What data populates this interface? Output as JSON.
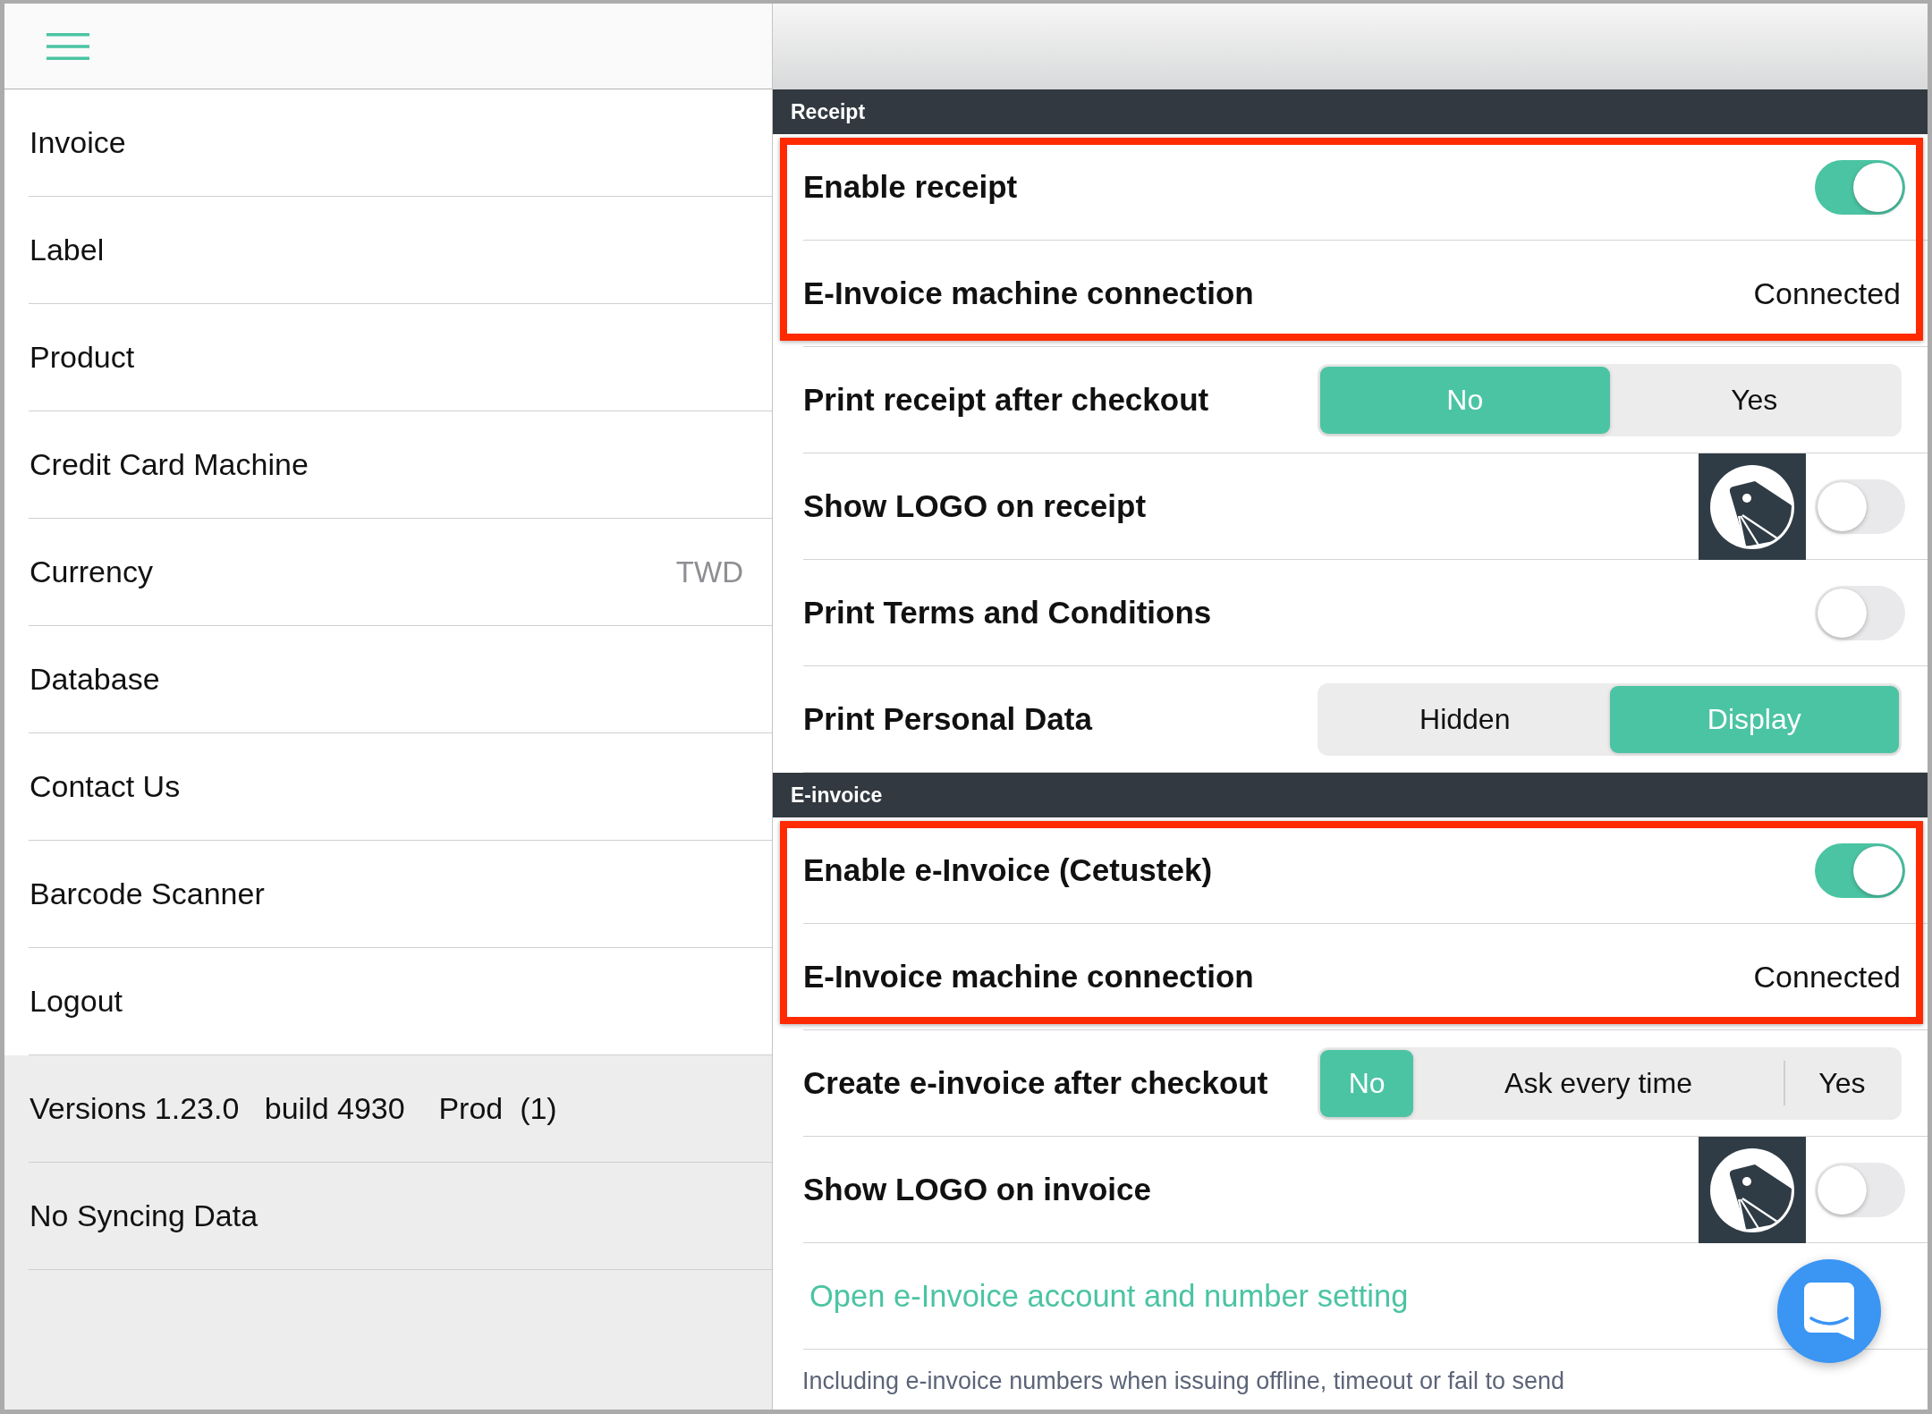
{
  "sidebar": {
    "items": [
      {
        "label": "Invoice"
      },
      {
        "label": "Label"
      },
      {
        "label": "Product"
      },
      {
        "label": "Credit Card Machine"
      },
      {
        "label": "Currency",
        "value": "TWD"
      },
      {
        "label": "Database"
      },
      {
        "label": "Contact Us"
      },
      {
        "label": "Barcode Scanner"
      },
      {
        "label": "Logout"
      }
    ],
    "footer": [
      {
        "text": "Versions 1.23.0   build 4930    Prod  (1)"
      },
      {
        "text": "No Syncing Data"
      }
    ]
  },
  "settings": {
    "sections": [
      {
        "title": "Receipt",
        "rows": [
          {
            "kind": "toggle",
            "label": "Enable receipt",
            "on": true,
            "highlighted": true
          },
          {
            "kind": "status",
            "label": "E-Invoice machine connection",
            "value": "Connected",
            "highlighted": true
          },
          {
            "kind": "segmented",
            "label": "Print receipt after checkout",
            "options": [
              {
                "label": "No",
                "selected": true
              },
              {
                "label": "Yes",
                "selected": false
              }
            ],
            "highlighted": false
          },
          {
            "kind": "logo_toggle",
            "label": "Show LOGO on receipt",
            "on": false,
            "highlighted": false
          },
          {
            "kind": "toggle",
            "label": "Print Terms and Conditions",
            "on": false,
            "highlighted": false
          },
          {
            "kind": "segmented",
            "label": "Print Personal Data",
            "options": [
              {
                "label": "Hidden",
                "selected": false
              },
              {
                "label": "Display",
                "selected": true
              }
            ],
            "highlighted": false
          }
        ]
      },
      {
        "title": "E-invoice",
        "rows": [
          {
            "kind": "toggle",
            "label": "Enable e-Invoice (Cetustek)",
            "on": true,
            "highlighted": true
          },
          {
            "kind": "status",
            "label": "E-Invoice machine connection",
            "value": "Connected",
            "highlighted": true
          },
          {
            "kind": "segmented",
            "label": "Create e-invoice after checkout",
            "options": [
              {
                "label": "No",
                "selected": true
              },
              {
                "label": "Ask every time",
                "selected": false
              },
              {
                "label": "Yes",
                "selected": false
              }
            ],
            "highlighted": false
          },
          {
            "kind": "logo_toggle",
            "label": "Show LOGO on invoice",
            "on": false,
            "highlighted": false
          },
          {
            "kind": "link",
            "label": "Open e-Invoice account and number setting",
            "highlighted": false
          },
          {
            "kind": "note",
            "label": "Including e-invoice numbers when issuing offline, timeout or fail to send",
            "highlighted": false
          }
        ]
      }
    ]
  }
}
